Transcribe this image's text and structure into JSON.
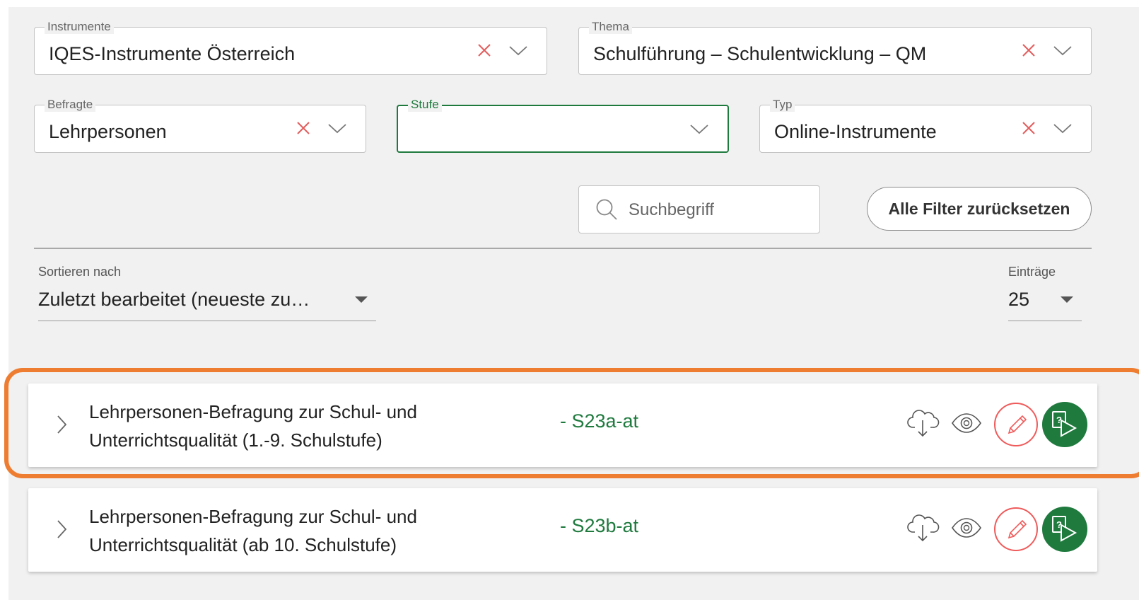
{
  "filters": {
    "instrumente": {
      "label": "Instrumente",
      "value": "IQES-Instrumente Österreich"
    },
    "thema": {
      "label": "Thema",
      "value": "Schulführung – Schulentwicklung – QM"
    },
    "befragte": {
      "label": "Befragte",
      "value": "Lehrpersonen"
    },
    "stufe": {
      "label": "Stufe",
      "value": ""
    },
    "typ": {
      "label": "Typ",
      "value": "Online-Instrumente"
    },
    "colors": {
      "clear_icon": "#e35d5d",
      "active_border": "#1f7a3e"
    }
  },
  "search": {
    "placeholder": "Suchbegriff"
  },
  "reset_label": "Alle Filter zurücksetzen",
  "sort": {
    "label": "Sortieren nach",
    "value": "Zuletzt bearbeitet (neueste zu…"
  },
  "entries": {
    "label": "Einträge",
    "value": "25"
  },
  "instruments": [
    {
      "title_line1": "Lehrpersonen-Befragung zur Schul- und",
      "title_line2": "Unterrichtsqualität (1.-9. Schulstufe)",
      "code": "- S23a-at",
      "highlighted": true
    },
    {
      "title_line1": "Lehrpersonen-Befragung zur Schul- und",
      "title_line2": "Unterrichtsqualität (ab 10. Schulstufe)",
      "code": "- S23b-at",
      "highlighted": false
    }
  ],
  "actions": [
    "cloud-download-icon",
    "eye-icon",
    "pencil-icon",
    "start-survey-icon"
  ],
  "colors": {
    "accent_green": "#1f7a3e",
    "highlight_orange": "#ee7d31",
    "edit_red": "#ef5b5b",
    "background": "#f1f1f1"
  }
}
